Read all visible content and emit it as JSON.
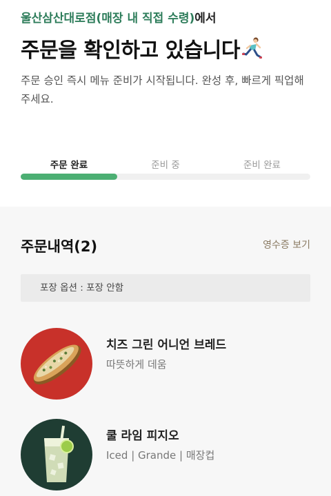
{
  "header": {
    "store_name": "울산삼산대로점(매장 내 직접 수령)",
    "store_suffix": "에서",
    "headline": "주문을 확인하고 있습니다",
    "description": "주문 승인 즉시 메뉴 준비가 시작됩니다. 완성 후, 빠르게 픽업해 주세요."
  },
  "progress": {
    "steps": [
      "주문 완료",
      "준비 중",
      "준비 완료"
    ],
    "current_step": 1,
    "fill_fraction": 0.333,
    "fill_color": "#4caf73"
  },
  "order": {
    "title": "주문내역(2)",
    "receipt_link": "영수증 보기",
    "packaging_option": "포장 옵션 : 포장 안함",
    "items": [
      {
        "name": "치즈 그린 어니언 브레드",
        "option": "따뜻하게 데움",
        "thumb_bg": "#c8312a",
        "icon": "bread-image"
      },
      {
        "name": "쿨 라임 피지오",
        "option": "Iced | Grande | 매장컵",
        "thumb_bg": "#1f3d33",
        "icon": "lime-drink-image"
      }
    ]
  },
  "colors": {
    "store_green": "#2e7d5b",
    "receipt_link": "#8a7a62"
  }
}
